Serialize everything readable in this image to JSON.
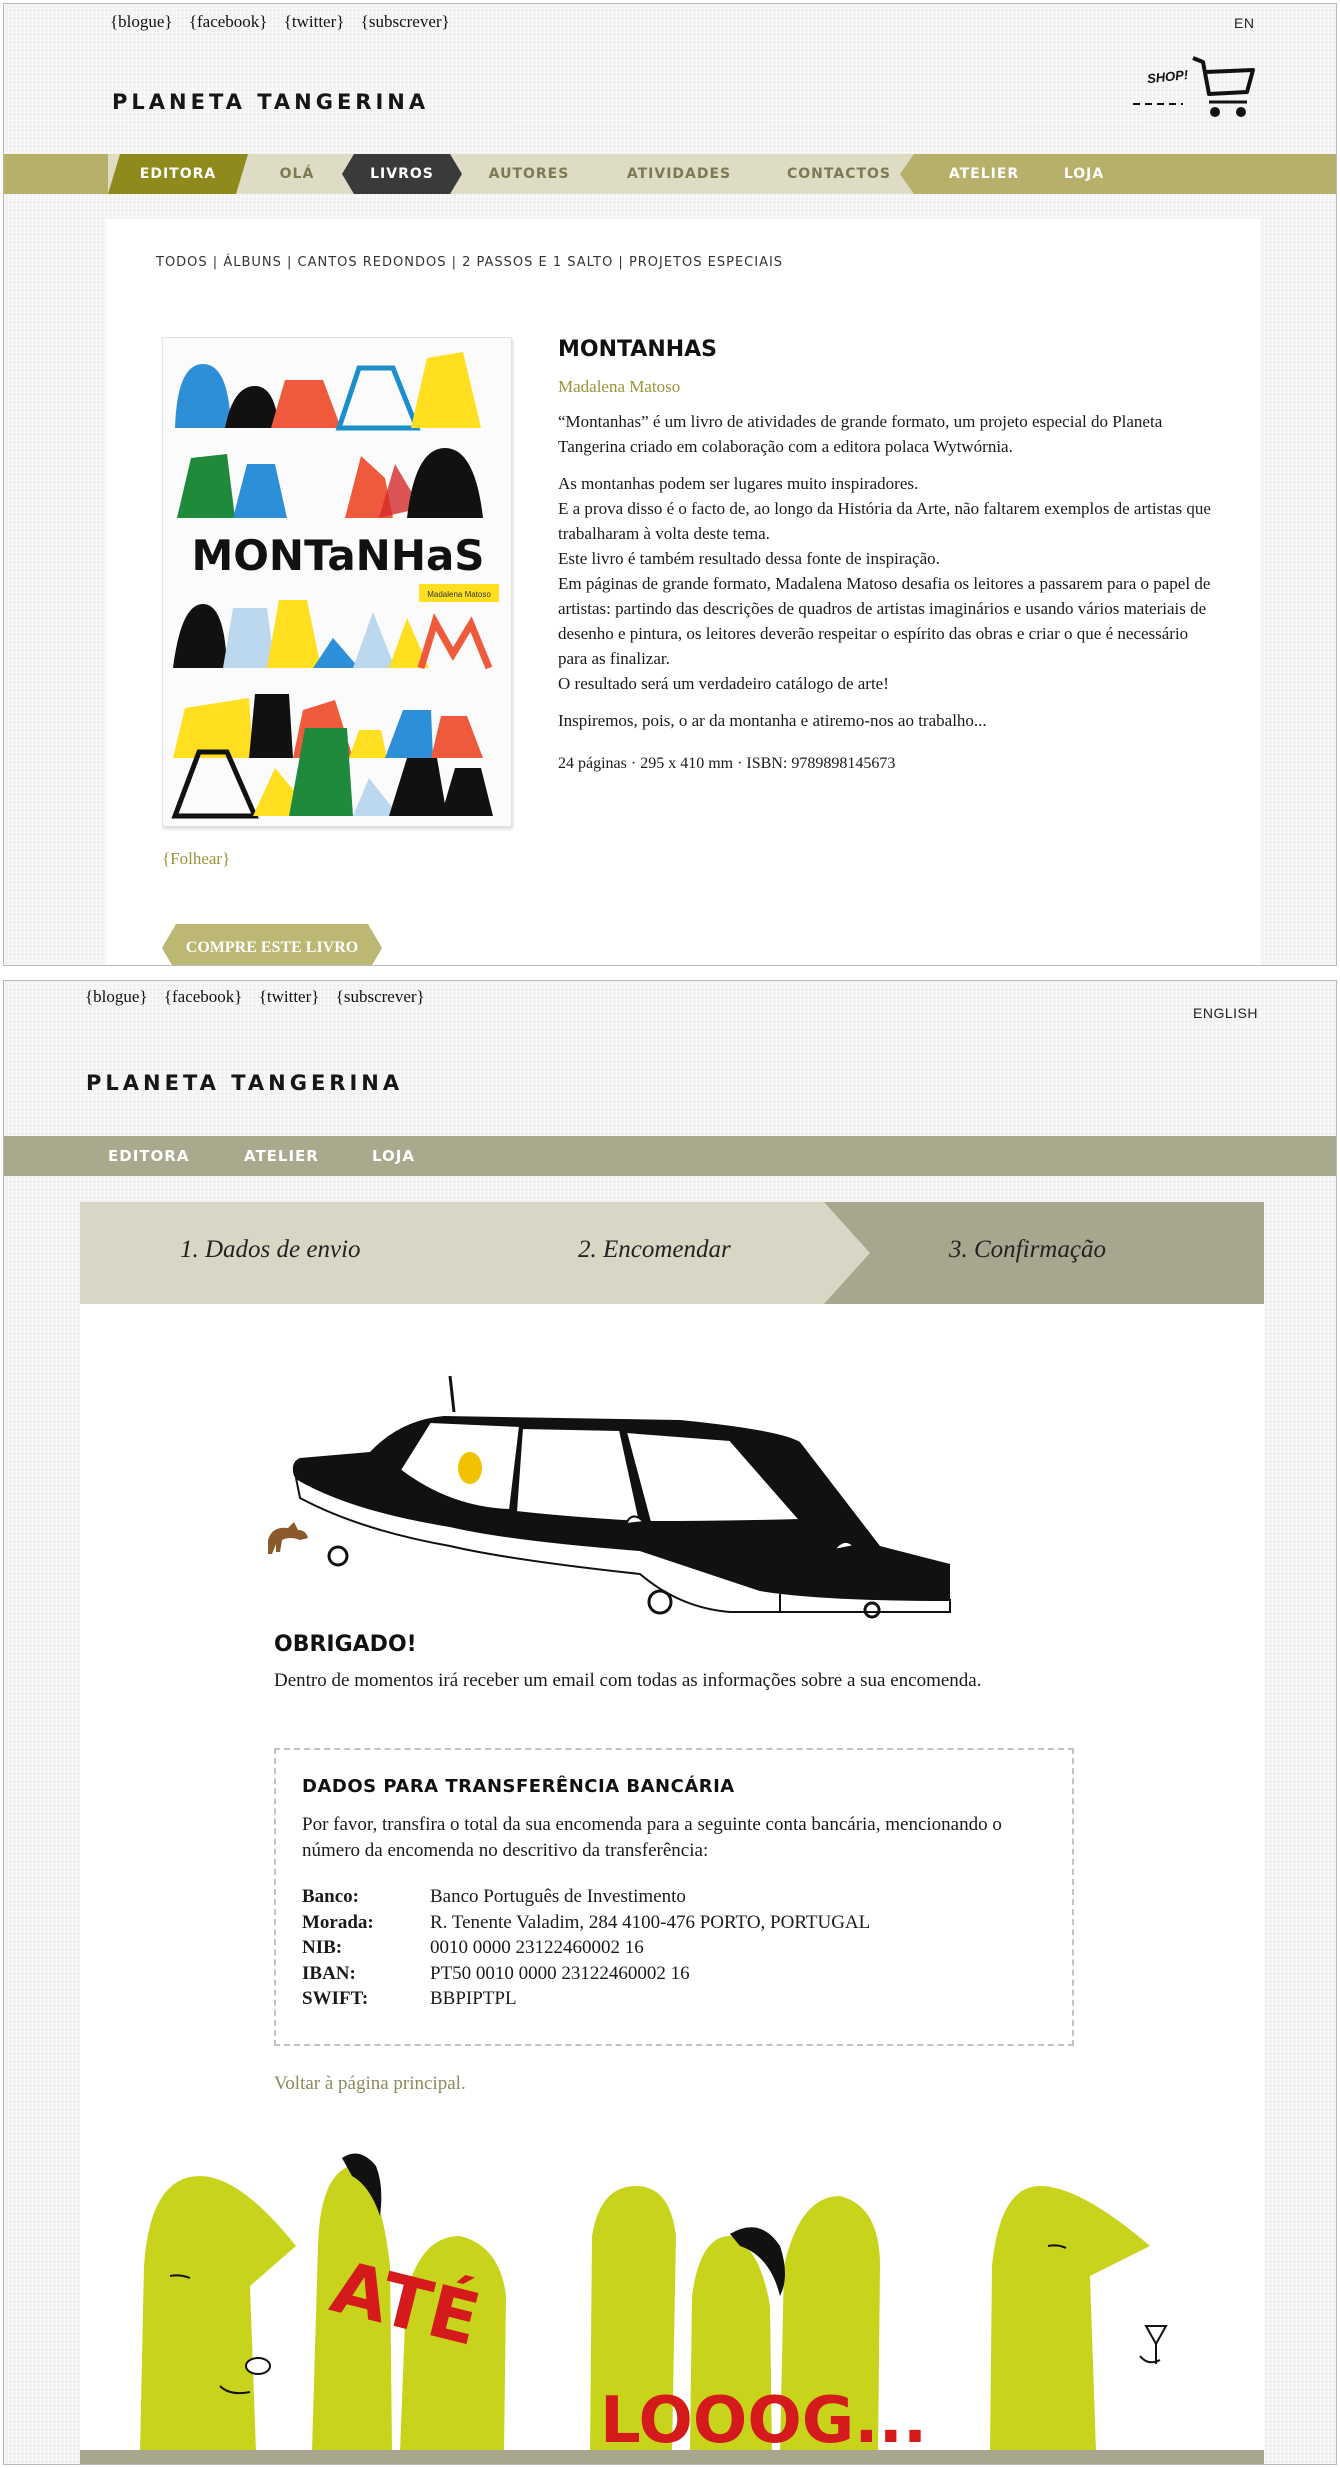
{
  "screen1": {
    "social": [
      "{blogue}",
      "{facebook}",
      "{twitter}",
      "{subscrever}"
    ],
    "lang": "EN",
    "logo": "PLANETA TANGERINA",
    "shop_label": "SHOP!",
    "nav": [
      "EDITORA",
      "OLÁ",
      "LIVROS",
      "AUTORES",
      "ATIVIDADES",
      "CONTACTOS",
      "ATELIER",
      "LOJA"
    ],
    "filters": "TODOS | ÁLBUNS | CANTOS REDONDOS | 2 PASSOS E 1 SALTO | PROJETOS ESPECIAIS",
    "cover": {
      "word": "MONTaNHaS",
      "tag": "Madalena Matoso"
    },
    "book": {
      "title": "MONTANHAS",
      "author": "Madalena Matoso",
      "paragraphs": [
        "“Montanhas” é um livro de atividades de grande formato, um projeto especial do Planeta Tangerina criado em colaboração com a editora polaca Wytwórnia.",
        "As montanhas podem ser lugares muito inspiradores.\nE a prova disso é o facto de, ao longo da História da Arte, não faltarem exemplos de artistas que trabalharam à volta deste tema.\nEste livro é também resultado dessa fonte de inspiração.\nEm páginas de grande formato, Madalena Matoso desafia os leitores a passarem para o papel de artistas: partindo das descrições de quadros de artistas imaginários e usando vários materiais de desenho e pintura, os leitores deverão respeitar o espírito das obras e criar o que é necessário para as finalizar.\nO resultado será um verdadeiro catálogo de arte!",
        "Inspiremos, pois, o ar da montanha e atiremo-nos ao trabalho...",
        "24 páginas · 295 x 410 mm · ISBN: 9789898145673"
      ]
    },
    "folhear": "{Folhear}",
    "buy_button": "COMPRE ESTE LIVRO"
  },
  "screen2": {
    "social": [
      "{blogue}",
      "{facebook}",
      "{twitter}",
      "{subscrever}"
    ],
    "lang": "ENGLISH",
    "logo": "PLANETA TANGERINA",
    "nav": [
      "EDITORA",
      "ATELIER",
      "LOJA"
    ],
    "steps": [
      "1. Dados de envio",
      "2. Encomendar",
      "3. Confirmação"
    ],
    "thanks_title": "OBRIGADO!",
    "thanks_text": "Dentro de momentos irá receber um email com todas as informações sobre a sua encomenda.",
    "bank": {
      "title": "DADOS PARA TRANSFERÊNCIA BANCÁRIA",
      "text": "Por favor, transfira o total da sua encomenda para a seguinte conta bancária, mencionando o número da encomenda no descritivo da transferência:",
      "rows": [
        {
          "k": "Banco:",
          "v": "Banco Português de Investimento"
        },
        {
          "k": "Morada:",
          "v": "R. Tenente Valadim, 284 4100-476 PORTO, PORTUGAL"
        },
        {
          "k": "NIB:",
          "v": "0010 0000 23122460002 16"
        },
        {
          "k": "IBAN:",
          "v": "PT50 0010 0000 23122460002 16"
        },
        {
          "k": "SWIFT:",
          "v": "BBPIPTPL"
        }
      ]
    },
    "back_link": "Voltar à página principal.",
    "illustration_text": [
      "ATÉ",
      "LOOOG..."
    ]
  },
  "colors": {
    "olive": "#b6b06b",
    "dark_olive": "#8f8a1c",
    "nav_dark": "#3a3a3a",
    "step_light": "#d8d6c4",
    "step_dark": "#a8a68f",
    "character_green": "#c8d41c",
    "text_red": "#d41a1a"
  }
}
